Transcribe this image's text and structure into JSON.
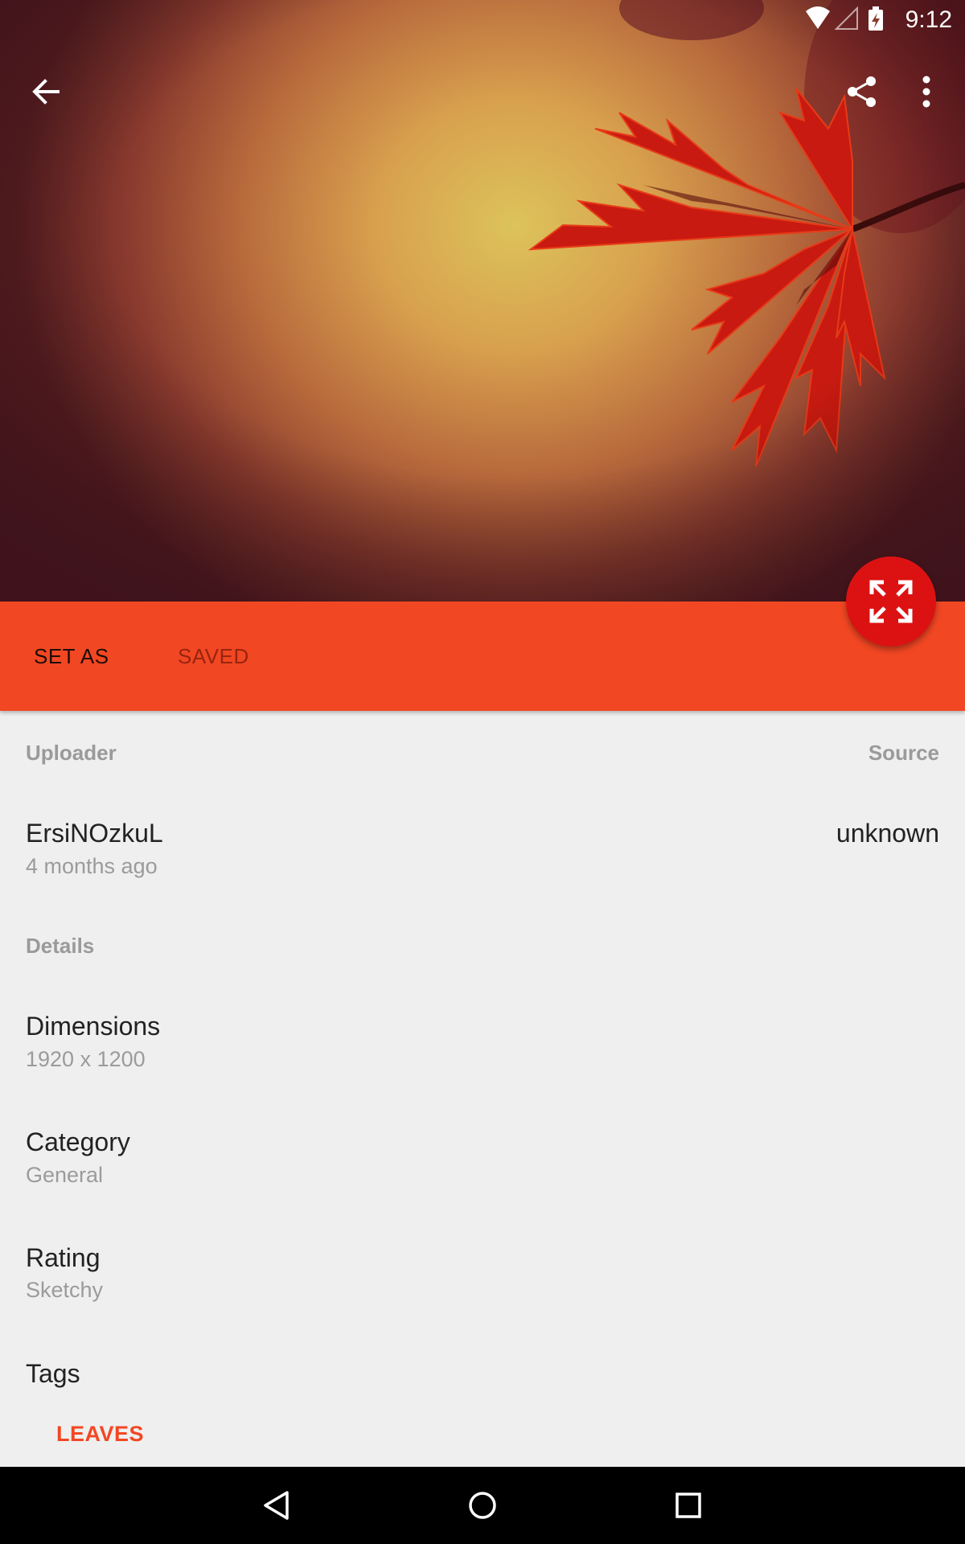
{
  "status_bar": {
    "time": "9:12",
    "icons": [
      "wifi-icon",
      "cell-signal-icon",
      "battery-charging-icon"
    ]
  },
  "toolbar": {
    "back_icon": "arrow-back-icon",
    "share_icon": "share-icon",
    "more_icon": "more-vert-icon"
  },
  "tabs": [
    {
      "label": "SET AS",
      "selected": true
    },
    {
      "label": "SAVED",
      "selected": false
    }
  ],
  "fab": {
    "icon": "fullscreen-expand-icon",
    "color": "#dc1212"
  },
  "colors": {
    "accent": "#f24723",
    "fab": "#dc1212",
    "background": "#efefef"
  },
  "info": {
    "uploader_header": "Uploader",
    "source_header": "Source",
    "uploader_name": "ErsiNOzkuL",
    "uploaded_time": "4 months ago",
    "source_value": "unknown"
  },
  "details": {
    "header": "Details",
    "items": [
      {
        "label": "Dimensions",
        "value": "1920 x 1200"
      },
      {
        "label": "Category",
        "value": "General"
      },
      {
        "label": "Rating",
        "value": "Sketchy"
      }
    ],
    "tags_label": "Tags",
    "tags": [
      "LEAVES"
    ]
  },
  "nav_bar": {
    "buttons": [
      "nav-back-icon",
      "nav-home-icon",
      "nav-recents-icon"
    ]
  }
}
